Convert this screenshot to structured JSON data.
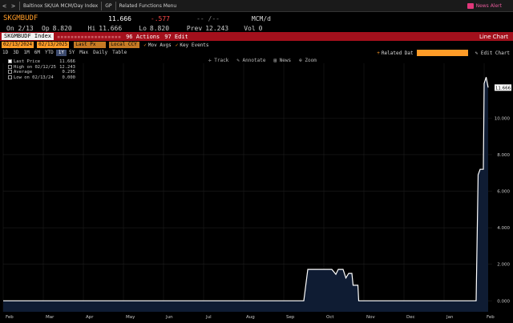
{
  "topbar": {
    "back": "<",
    "forward": ">",
    "title": "Baltinox SK/UA MCM/Day Index",
    "menu1": "GP",
    "menu2": "Related Functions Menu",
    "news_alert": "News Alert"
  },
  "ticker_row": {
    "ticker": "SKGMBUDF",
    "last": "11.666",
    "change": "-.577",
    "dash": "-- /--",
    "unit": "MCM/d"
  },
  "quote_row": {
    "date": "On 2/13",
    "open_label": "Op",
    "open": "8.820",
    "high_label": "Hi",
    "high": "11.666",
    "low_label": "Lo",
    "low": "8.820",
    "prev_label": "Prev",
    "prev": "12.243",
    "vol_label": "Vol",
    "vol": "0"
  },
  "redbar": {
    "ticker": "SKGMBUDF Index",
    "actions": "96 Actions",
    "edit": "97 Edit",
    "title": "Line Chart"
  },
  "params": {
    "start_date": "02/13/2024",
    "end_date": "02/13/2025",
    "last_price": "Last Px",
    "local_ccy": "Local CCY",
    "mov_avgs": "Mov Avgs",
    "key_events": "Key Events"
  },
  "ranges": [
    "1D",
    "3D",
    "1M",
    "6M",
    "YTD",
    "1Y",
    "5Y",
    "Max",
    "Daily",
    "Table"
  ],
  "selected_range": "1Y",
  "range_right": {
    "related_date": "Related Dat",
    "edit_chart": "Edit Chart"
  },
  "chart_toolbar": [
    "Track",
    "Annotate",
    "News",
    "Zoom"
  ],
  "legend": [
    {
      "label": "Last Price",
      "value": "11.666"
    },
    {
      "label": "High on 02/12/25",
      "value": "12.243"
    },
    {
      "label": "Average",
      "value": "0.295"
    },
    {
      "label": "Low on 02/13/24",
      "value": "0.000"
    }
  ],
  "chart_data": {
    "type": "area",
    "x_tick_labels": [
      "Feb",
      "Mar",
      "Apr",
      "May",
      "Jun",
      "Jul",
      "Aug",
      "Sep",
      "Oct",
      "Nov",
      "Dec",
      "Jan",
      "Feb"
    ],
    "y_tick_labels": [
      "0.000",
      "2.000",
      "4.000",
      "6.000",
      "8.000",
      "10.000"
    ],
    "ylim": [
      -0.6,
      13
    ],
    "last_value_label": "11.666",
    "series": [
      {
        "values": [
          {
            "x": 0,
            "y": 0
          },
          {
            "x": 7.5,
            "y": 0
          },
          {
            "x": 7.6,
            "y": 1.72
          },
          {
            "x": 8.2,
            "y": 1.72
          },
          {
            "x": 8.3,
            "y": 1.45
          },
          {
            "x": 8.36,
            "y": 1.72
          },
          {
            "x": 8.48,
            "y": 1.72
          },
          {
            "x": 8.55,
            "y": 1.25
          },
          {
            "x": 8.62,
            "y": 1.5
          },
          {
            "x": 8.7,
            "y": 1.5
          },
          {
            "x": 8.73,
            "y": 0.85
          },
          {
            "x": 8.85,
            "y": 0.85
          },
          {
            "x": 8.87,
            "y": 0
          },
          {
            "x": 11.8,
            "y": 0
          },
          {
            "x": 11.85,
            "y": 6.9
          },
          {
            "x": 11.9,
            "y": 7.2
          },
          {
            "x": 11.98,
            "y": 7.2
          },
          {
            "x": 12.0,
            "y": 11.9
          },
          {
            "x": 12.05,
            "y": 12.24
          },
          {
            "x": 12.1,
            "y": 11.67
          }
        ]
      }
    ],
    "colors": {
      "fill": "#0f1c33",
      "line": "#ffffff",
      "grid": "#1d1d1d"
    }
  }
}
